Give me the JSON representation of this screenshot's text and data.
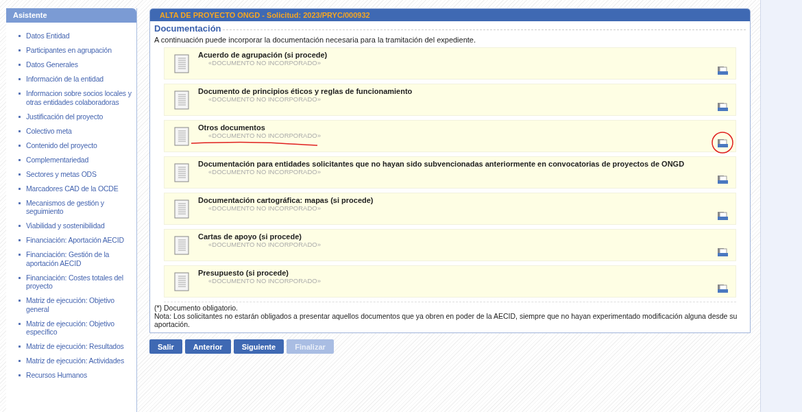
{
  "sidebar": {
    "title": "Asistente",
    "items": [
      {
        "label": "Datos Entidad"
      },
      {
        "label": "Participantes en agrupación"
      },
      {
        "label": "Datos Generales"
      },
      {
        "label": "Información de la entidad"
      },
      {
        "label": "Informacion sobre socios locales y otras entidades colaboradoras"
      },
      {
        "label": "Justificación del proyecto"
      },
      {
        "label": "Colectivo meta"
      },
      {
        "label": "Contenido del proyecto"
      },
      {
        "label": "Complementariedad"
      },
      {
        "label": "Sectores y metas ODS"
      },
      {
        "label": "Marcadores CAD de la OCDE"
      },
      {
        "label": "Mecanismos de gestión y seguimiento"
      },
      {
        "label": "Viabilidad y sostenibilidad"
      },
      {
        "label": "Financiación: Aportación AECID"
      },
      {
        "label": "Financiación: Gestión de la aportación AECID"
      },
      {
        "label": "Financiación: Costes totales del proyecto"
      },
      {
        "label": "Matriz de ejecución: Objetivo general"
      },
      {
        "label": "Matriz de ejecución: Objetivo específico"
      },
      {
        "label": "Matriz de ejecución: Resultados"
      },
      {
        "label": "Matriz de ejecución: Actividades"
      },
      {
        "label": "Recursos Humanos"
      }
    ]
  },
  "panel": {
    "title": "ALTA DE PROYECTO ONGD - Solicitud: 2023/PRYC/000932",
    "section": "Documentación",
    "intro": "A continuación puede incorporar la documentación necesaria para la tramitación del expediente.",
    "documents": [
      {
        "title": "Acuerdo de agrupación (si procede)",
        "status": "«DOCUMENTO NO INCORPORADO»",
        "annotated": false
      },
      {
        "title": "Documento de principios éticos y reglas de funcionamiento",
        "status": "«DOCUMENTO NO INCORPORADO»",
        "annotated": false
      },
      {
        "title": "Otros documentos",
        "status": "«DOCUMENTO NO INCORPORADO»",
        "annotated": true
      },
      {
        "title": "Documentación para entidades solicitantes que no hayan sido subvencionadas anteriormente en convocatorias de proyectos de ONGD",
        "status": "«DOCUMENTO NO INCORPORADO»",
        "annotated": false
      },
      {
        "title": "Documentación cartográfica: mapas (si procede)",
        "status": "«DOCUMENTO NO INCORPORADO»",
        "annotated": false
      },
      {
        "title": "Cartas de apoyo (si procede)",
        "status": "«DOCUMENTO NO INCORPORADO»",
        "annotated": false
      },
      {
        "title": "Presupuesto (si procede)",
        "status": "«DOCUMENTO NO INCORPORADO»",
        "annotated": false
      }
    ],
    "footnote": "(*) Documento obligatorio.",
    "note": "Nota: Los solicitantes no estarán obligados a presentar aquellos documentos que ya obren en poder de la AECID, siempre que no hayan experimentado modificación alguna desde su aportación."
  },
  "buttons": [
    {
      "label": "Salir",
      "disabled": false
    },
    {
      "label": "Anterior",
      "disabled": false
    },
    {
      "label": "Siguiente",
      "disabled": false
    },
    {
      "label": "Finalizar",
      "disabled": true
    }
  ]
}
